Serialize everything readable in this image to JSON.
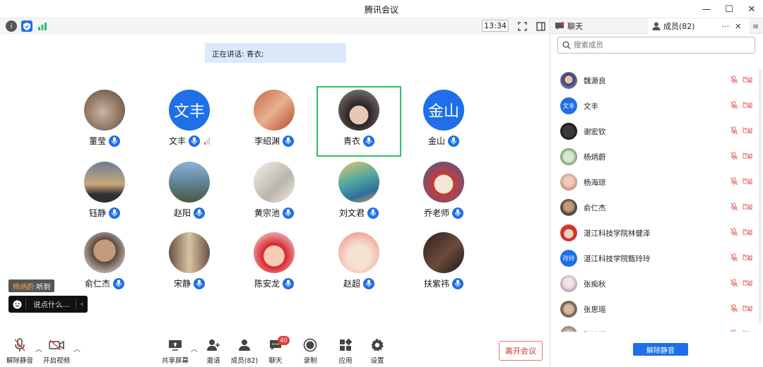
{
  "window": {
    "title": "腾讯会议"
  },
  "top_bar": {
    "time": "13:34"
  },
  "speaking_banner": "正在讲话: 青衣;",
  "participants": [
    {
      "name": "董莹",
      "avatar": "cat-photo"
    },
    {
      "name": "文丰",
      "avatar_text": "文丰",
      "signal": true
    },
    {
      "name": "李绍渊",
      "avatar": "seal-photo"
    },
    {
      "name": "青衣",
      "avatar": "woman-photo",
      "active": true
    },
    {
      "name": "金山",
      "avatar_text": "金山"
    },
    {
      "name": "钰静",
      "avatar": "sunset-photo"
    },
    {
      "name": "赵阳",
      "avatar": "person-mountain-photo"
    },
    {
      "name": "黄宗池",
      "avatar": "ink-painting"
    },
    {
      "name": "刘文君",
      "avatar": "landscape-painting"
    },
    {
      "name": "乔老师",
      "avatar": "cartoon-tiger"
    },
    {
      "name": "俞仁杰",
      "avatar": "man-photo"
    },
    {
      "name": "宋静",
      "avatar": "mirror-photo"
    },
    {
      "name": "陈安龙",
      "avatar": "baby-photo"
    },
    {
      "name": "赵超",
      "avatar": "2022-cartoon"
    },
    {
      "name": "扶紫祎",
      "avatar": "dark-photo"
    }
  ],
  "subtitle": {
    "speaker": "杨炳蔚:",
    "text": "听到"
  },
  "chat_input": {
    "placeholder": "说点什么..."
  },
  "toolbar": {
    "unmute": "解除静音",
    "video": "开启视频",
    "share": "共享屏幕",
    "invite": "邀请",
    "members": "成员(82)",
    "chat": "聊天",
    "chat_badge": "40",
    "record": "录制",
    "apps": "应用",
    "settings": "设置",
    "leave": "离开会议"
  },
  "panel": {
    "tab_chat": "聊天",
    "tab_members": "成员(82)",
    "search_placeholder": "搜索成员",
    "members": [
      {
        "name": "魏源良",
        "avatar": "photo"
      },
      {
        "name": "文丰",
        "avatar_text": "文丰"
      },
      {
        "name": "谢宏钦",
        "avatar": "photo"
      },
      {
        "name": "杨炳蔚",
        "avatar": "photo"
      },
      {
        "name": "杨海琼",
        "avatar": "photo"
      },
      {
        "name": "俞仁杰",
        "avatar": "photo"
      },
      {
        "name": "湛江科技学院林健泽",
        "avatar": "cartoon"
      },
      {
        "name": "湛江科技学院甄玲玲",
        "avatar_text": "玲玲"
      },
      {
        "name": "张痴秋",
        "avatar": "photo"
      },
      {
        "name": "张思瑶",
        "avatar": "photo"
      },
      {
        "name": "张清妍",
        "avatar": "photo"
      }
    ],
    "unmute_all": "解除静音"
  },
  "colors": {
    "accent": "#1e6fe8",
    "active_border": "#2ebf6f",
    "leave": "#d9302c",
    "badge": "#e53935"
  }
}
